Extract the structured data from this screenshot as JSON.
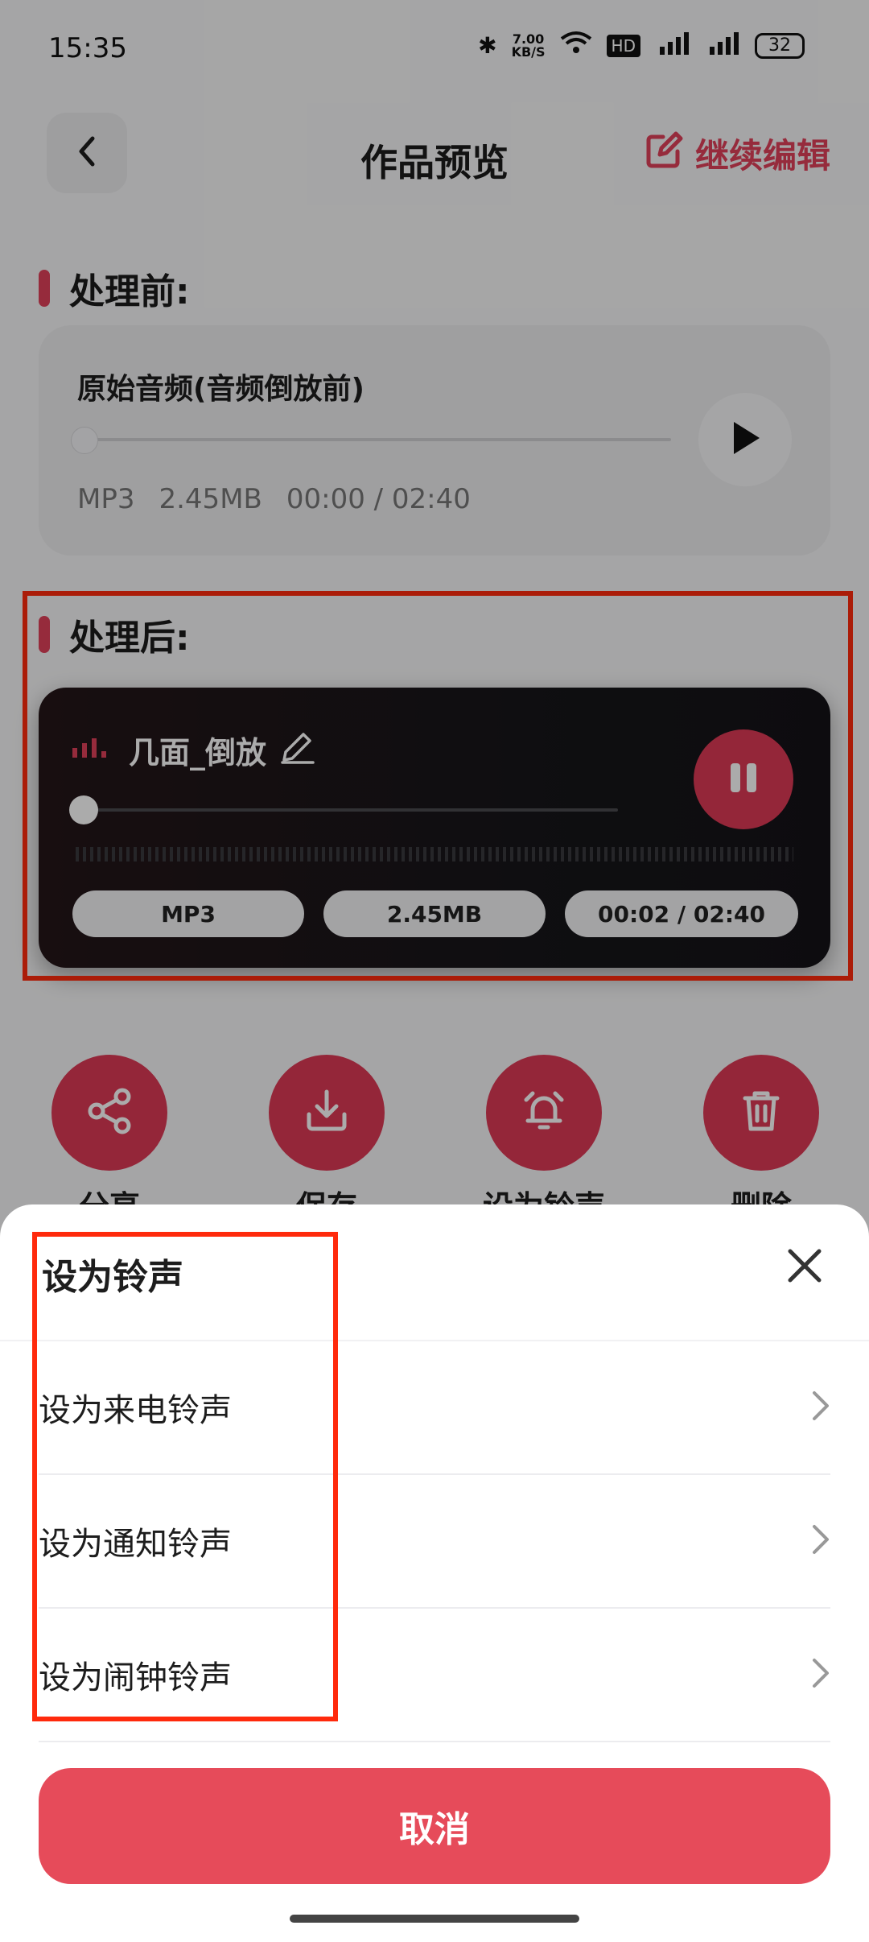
{
  "status_bar": {
    "time": "15:35",
    "net_speed_value": "7.00",
    "net_speed_unit": "KB/S",
    "battery": "32"
  },
  "nav": {
    "title": "作品预览",
    "continue_edit": "继续编辑"
  },
  "before": {
    "section_label": "处理前:",
    "audio_title": "原始音频(音频倒放前)",
    "format": "MP3",
    "size": "2.45MB",
    "time": "00:00 / 02:40"
  },
  "after": {
    "section_label": "处理后:",
    "audio_title": "几面_倒放",
    "format": "MP3",
    "size": "2.45MB",
    "time": "00:02 / 02:40"
  },
  "actions": [
    {
      "label": "分享",
      "icon": "share-icon"
    },
    {
      "label": "保存",
      "icon": "download-icon"
    },
    {
      "label": "设为铃声",
      "icon": "alarm-bell-icon"
    },
    {
      "label": "删除",
      "icon": "trash-icon"
    }
  ],
  "sheet": {
    "title": "设为铃声",
    "options": [
      {
        "label": "设为来电铃声"
      },
      {
        "label": "设为通知铃声"
      },
      {
        "label": "设为闹钟铃声"
      }
    ],
    "cancel": "取消"
  },
  "colors": {
    "accent": "#e0415a",
    "cancel_button": "#e64b5a",
    "highlight": "#ff2a0c"
  }
}
